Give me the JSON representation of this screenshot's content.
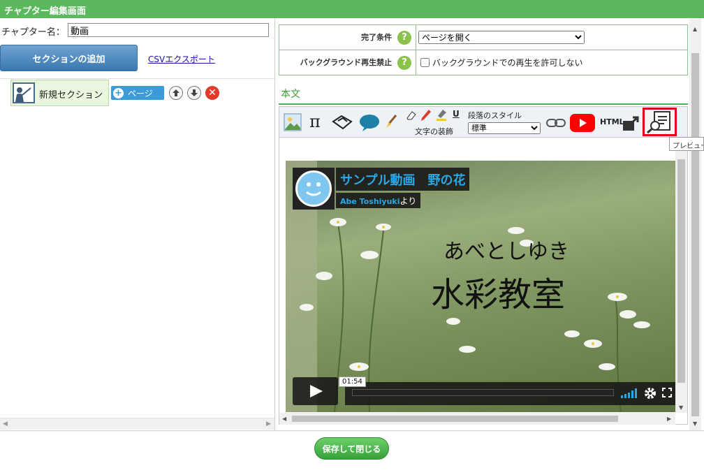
{
  "window": {
    "title": "チャプター編集画面"
  },
  "left": {
    "chapter_label": "チャプター名：",
    "chapter_name_value": "動画",
    "add_section_label": "セクションの追加",
    "csv_export_label": "CSVエクスポート",
    "section": {
      "label": "新規セクション",
      "page_button_label": "ページ"
    }
  },
  "settings": {
    "completion_label": "完了条件",
    "completion_value": "ページを開く",
    "background_label": "バックグラウンド再生禁止",
    "background_checkbox_label": "バックグラウンドでの再生を許可しない",
    "background_checked": false
  },
  "editor": {
    "heading": "本文",
    "paragraph_style_label": "段落のスタイル",
    "paragraph_style_value": "標準",
    "text_decoration_label": "文字の装飾",
    "html_label": "HTML",
    "preview_tooltip": "プレビュー"
  },
  "video": {
    "title": "サンプル動画　野の花",
    "author": "Abe Toshiyuki",
    "byline_suffix": "より",
    "headline_1": "あべとしゆき",
    "headline_2": "水彩教室",
    "time": "01:54"
  },
  "footer": {
    "save_close_label": "保存して閉じる"
  },
  "colors": {
    "titlebar": "#5cb85c",
    "accent_green": "#4caf50",
    "button_blue": "#3a78b0",
    "preview_highlight": "#e0001b",
    "video_title": "#2aa8e8"
  }
}
